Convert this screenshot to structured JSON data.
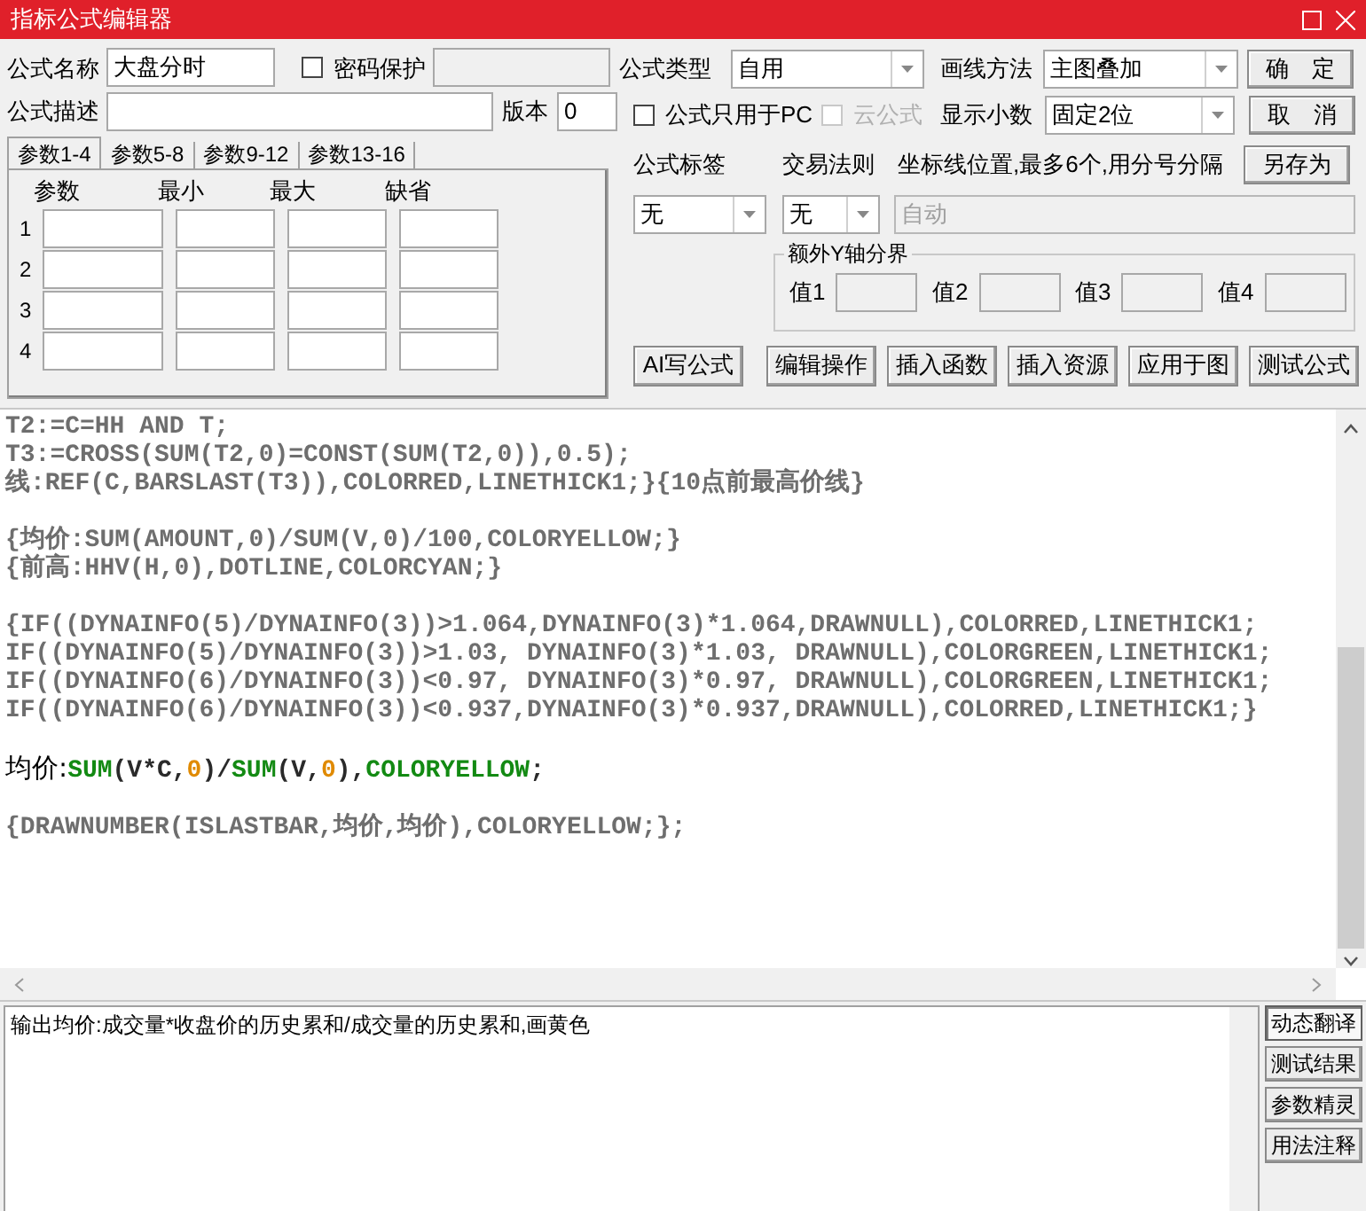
{
  "window": {
    "title": "指标公式编辑器"
  },
  "form": {
    "name_label": "公式名称",
    "name_value": "大盘分时",
    "password": {
      "label": "密码保护",
      "checked": false
    },
    "desc_label": "公式描述",
    "version_label": "版本",
    "version_value": "0",
    "type_label": "公式类型",
    "type_value": "自用",
    "draw_label": "画线方法",
    "draw_value": "主图叠加",
    "pc_only": {
      "label": "公式只用于PC",
      "checked": false,
      "disabled": false
    },
    "cloud": {
      "label": "云公式",
      "checked": false,
      "disabled": true
    },
    "decimals_label": "显示小数",
    "decimals_value": "固定2位",
    "tag_label": "公式标签",
    "tag_value": "无",
    "rule_label": "交易法则",
    "rule_value": "无",
    "axis_label": "坐标线位置,最多6个,用分号分隔",
    "axis_placeholder": "自动",
    "yaxis": {
      "title": "额外Y轴分界",
      "labels": [
        "值1",
        "值2",
        "值3",
        "值4"
      ]
    }
  },
  "side_buttons": [
    "确　定",
    "取　消",
    "另存为"
  ],
  "param_tabs": [
    {
      "label": "参数1-4",
      "selected": true
    },
    {
      "label": "参数5-8",
      "selected": false
    },
    {
      "label": "参数9-12",
      "selected": false
    },
    {
      "label": "参数13-16",
      "selected": false
    }
  ],
  "param_columns": [
    "参数",
    "最小",
    "最大",
    "缺省"
  ],
  "param_rows": [
    "1",
    "2",
    "3",
    "4"
  ],
  "action_buttons": [
    "AI写公式",
    "编辑操作",
    "插入函数",
    "插入资源",
    "应用于图",
    "测试公式"
  ],
  "code_lines": [
    {
      "kind": "code",
      "segments": [
        {
          "kind": "plain",
          "text": "T2:=C=HH AND T;"
        }
      ]
    },
    {
      "kind": "code",
      "segments": [
        {
          "kind": "plain",
          "text": "T3:=CROSS(SUM(T2,0)=CONST(SUM(T2,0)),0.5);"
        }
      ]
    },
    {
      "kind": "code",
      "segments": [
        {
          "kind": "plain",
          "text": "线:REF(C,BARSLAST(T3)),COLORRED,LINETHICK1;}{10点前最高价线}"
        }
      ]
    },
    {
      "kind": "blank"
    },
    {
      "kind": "code",
      "segments": [
        {
          "kind": "plain",
          "text": "{均价:SUM(AMOUNT,0)/SUM(V,0)/100,COLORYELLOW;}"
        }
      ]
    },
    {
      "kind": "code",
      "segments": [
        {
          "kind": "plain",
          "text": "{前高:HHV(H,0),DOTLINE,COLORCYAN;}"
        }
      ]
    },
    {
      "kind": "blank"
    },
    {
      "kind": "code",
      "segments": [
        {
          "kind": "plain",
          "text": "{IF((DYNAINFO(5)/DYNAINFO(3))>1.064,DYNAINFO(3)*1.064,DRAWNULL),COLORRED,LINETHICK1;"
        }
      ]
    },
    {
      "kind": "code",
      "segments": [
        {
          "kind": "plain",
          "text": "IF((DYNAINFO(5)/DYNAINFO(3))>1.03, DYNAINFO(3)*1.03, DRAWNULL),COLORGREEN,LINETHICK1;"
        }
      ]
    },
    {
      "kind": "code",
      "segments": [
        {
          "kind": "plain",
          "text": "IF((DYNAINFO(6)/DYNAINFO(3))<0.97, DYNAINFO(3)*0.97, DRAWNULL),COLORGREEN,LINETHICK1;"
        }
      ]
    },
    {
      "kind": "code",
      "segments": [
        {
          "kind": "plain",
          "text": "IF((DYNAINFO(6)/DYNAINFO(3))<0.937,DYNAINFO(3)*0.937,DRAWNULL),COLORRED,LINETHICK1;}"
        }
      ]
    },
    {
      "kind": "blank"
    },
    {
      "kind": "code",
      "segments": [
        {
          "kind": "name",
          "text": "均价:"
        },
        {
          "kind": "function",
          "text": "SUM"
        },
        {
          "kind": "symbol",
          "text": "(V*C,"
        },
        {
          "kind": "number",
          "text": "0"
        },
        {
          "kind": "symbol",
          "text": ")/"
        },
        {
          "kind": "function",
          "text": "SUM"
        },
        {
          "kind": "symbol",
          "text": "(V,"
        },
        {
          "kind": "number",
          "text": "0"
        },
        {
          "kind": "symbol",
          "text": "),"
        },
        {
          "kind": "function",
          "text": "COLORYELLOW"
        },
        {
          "kind": "symbol",
          "text": ";"
        }
      ]
    },
    {
      "kind": "blank"
    },
    {
      "kind": "code",
      "segments": [
        {
          "kind": "plain",
          "text": "{DRAWNUMBER(ISLASTBAR,均价,均价),COLORYELLOW;};"
        }
      ]
    }
  ],
  "translation": "输出均价:成交量*收盘价的历史累和/成交量的历史累和,画黄色",
  "bottom_tabs": [
    {
      "label": "动态翻译",
      "selected": true
    },
    {
      "label": "测试结果",
      "selected": false
    },
    {
      "label": "参数精灵",
      "selected": false
    },
    {
      "label": "用法注释",
      "selected": false
    }
  ]
}
